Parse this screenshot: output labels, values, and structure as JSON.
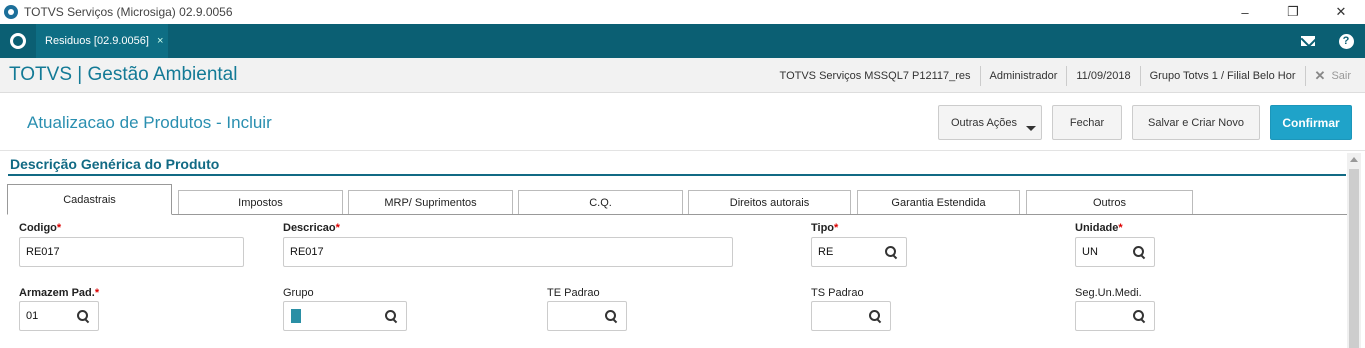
{
  "window": {
    "title": "TOTVS Serviços (Microsiga) 02.9.0056",
    "minimize": "–",
    "restore": "❐",
    "close": "✕"
  },
  "tabbar": {
    "doc_tab_label": "Residuos [02.9.0056]",
    "doc_tab_close": "×"
  },
  "module": {
    "title": "TOTVS | Gestão Ambiental",
    "environment": "TOTVS Serviços MSSQL7 P12117_res",
    "user": "Administrador",
    "date": "11/09/2018",
    "branch": "Grupo Totvs 1 / Filial Belo Hor",
    "exit_label": "Sair",
    "exit_icon": "✕"
  },
  "page": {
    "title": "Atualizacao de Produtos - Incluir"
  },
  "actions": {
    "more_label": "Outras Ações",
    "close_label": "Fechar",
    "save_new_label": "Salvar e Criar Novo",
    "confirm_label": "Confirmar"
  },
  "section": {
    "title": "Descrição Genérica do Produto"
  },
  "tabs": [
    {
      "label": "Cadastrais",
      "active": true
    },
    {
      "label": "Impostos",
      "active": false
    },
    {
      "label": "MRP/ Suprimentos",
      "active": false
    },
    {
      "label": "C.Q.",
      "active": false
    },
    {
      "label": "Direitos autorais",
      "active": false
    },
    {
      "label": "Garantia Estendida",
      "active": false
    },
    {
      "label": "Outros",
      "active": false
    }
  ],
  "form": {
    "codigo": {
      "label": "Codigo",
      "required_mark": "*",
      "value": "RE017"
    },
    "descricao": {
      "label": "Descricao",
      "required_mark": "*",
      "value": "RE017"
    },
    "tipo": {
      "label": "Tipo",
      "required_mark": "*",
      "value": "RE"
    },
    "unidade": {
      "label": "Unidade",
      "required_mark": "*",
      "value": "UN"
    },
    "armazem": {
      "label": "Armazem Pad.",
      "required_mark": "*",
      "value": "01"
    },
    "grupo": {
      "label": "Grupo",
      "value": ""
    },
    "te_padrao": {
      "label": "TE Padrao",
      "value": ""
    },
    "ts_padrao": {
      "label": "TS Padrao",
      "value": ""
    },
    "seg_un": {
      "label": "Seg.Un.Medi.",
      "value": ""
    }
  },
  "colors": {
    "tabbar": "#0b5f73",
    "accent": "#1fa3c9",
    "title": "#137a96",
    "required": "#dd0000"
  }
}
